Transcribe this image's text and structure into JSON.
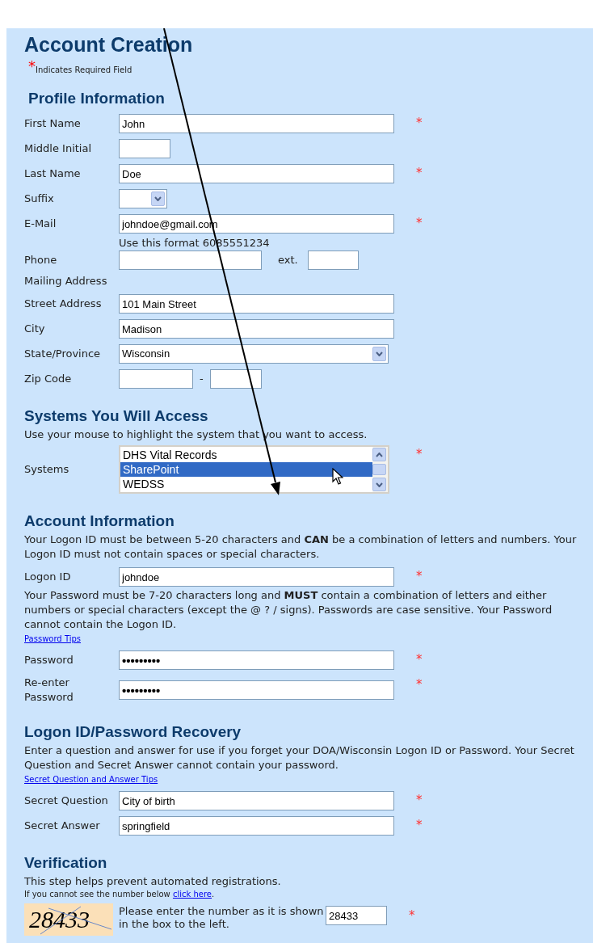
{
  "title": "Account Creation",
  "required_note": {
    "mark": "*",
    "text": "Indicates Required Field"
  },
  "sections": [
    {
      "heading": "Profile Information",
      "items": [
        {
          "kind": "text",
          "label": "First Name",
          "value": "John",
          "required_mark": "*"
        },
        {
          "kind": "short",
          "label": "Middle Initial"
        },
        {
          "kind": "text",
          "label": "Last Name",
          "value": "Doe",
          "required_mark": "*"
        },
        {
          "kind": "select-short",
          "label": "Suffix"
        },
        {
          "kind": "text",
          "label": "E-Mail",
          "value": "johndoe@gmail.com",
          "required_mark": "*"
        },
        {
          "kind": "phone",
          "label": "Phone",
          "hint": "Use this format 6085551234",
          "ext_label": "ext."
        },
        {
          "kind": "caption",
          "text": "Mailing Address"
        },
        {
          "kind": "text",
          "label": "Street Address",
          "value": "101 Main Street"
        },
        {
          "kind": "text",
          "label": "City",
          "value": "Madison"
        },
        {
          "kind": "select",
          "label": "State/Province",
          "value": "Wisconsin"
        },
        {
          "kind": "zip",
          "label": "Zip Code",
          "separator": "-"
        }
      ]
    },
    {
      "heading": "Systems You Will Access",
      "items": [
        {
          "kind": "paragraph",
          "text": "Use your mouse to highlight the system that you want to access."
        },
        {
          "kind": "listbox",
          "label": "Systems",
          "required_mark": "*",
          "options": [
            {
              "label": "DHS Vital Records",
              "selected": false
            },
            {
              "label": "SharePoint",
              "selected": true
            },
            {
              "label": "WEDSS",
              "selected": false
            }
          ]
        }
      ]
    },
    {
      "heading": "Account Information",
      "items": [
        {
          "kind": "paragraph",
          "text": "Your Logon ID must be between 5-20 characters and **CAN** be a combination of letters and numbers. Your Logon ID must not contain spaces or special characters."
        },
        {
          "kind": "text",
          "label": "Logon ID",
          "value": "johndoe",
          "required_mark": "*"
        },
        {
          "kind": "paragraph",
          "text": "Your Password must be 7-20 characters long and **MUST** contain a combination of letters and either numbers or special characters (except the @ ? / signs). Passwords are case sensitive. Your Password cannot contain the Logon ID."
        },
        {
          "kind": "link",
          "text": "Password Tips"
        },
        {
          "kind": "password",
          "label": "Password",
          "value": "•••••••••",
          "required_mark": "*"
        },
        {
          "kind": "password",
          "label": "Re-enter Password",
          "value": "•••••••••",
          "required_mark": "*"
        }
      ]
    },
    {
      "heading": "Logon ID/Password Recovery",
      "items": [
        {
          "kind": "paragraph",
          "text": "Enter a question and answer for use if you forget your DOA/Wisconsin Logon ID or Password. Your Secret Question and Secret Answer cannot contain your password."
        },
        {
          "kind": "link",
          "text": "Secret Question and Answer Tips"
        },
        {
          "kind": "text",
          "label": "Secret Question",
          "value": "City of birth",
          "required_mark": "*"
        },
        {
          "kind": "text",
          "label": "Secret Answer",
          "value": "springfield",
          "required_mark": "*"
        }
      ]
    },
    {
      "heading": "Verification",
      "items": [
        {
          "kind": "paragraph",
          "text": "This step helps prevent automated registrations."
        },
        {
          "kind": "small_note",
          "text": "If you cannot see the number below",
          "link": "click here",
          "after": "."
        },
        {
          "kind": "captcha",
          "image_text": "28433",
          "instruction": "Please enter the number as it is shown in the box to the left.",
          "value": "28433",
          "required_mark": "*"
        }
      ]
    }
  ]
}
